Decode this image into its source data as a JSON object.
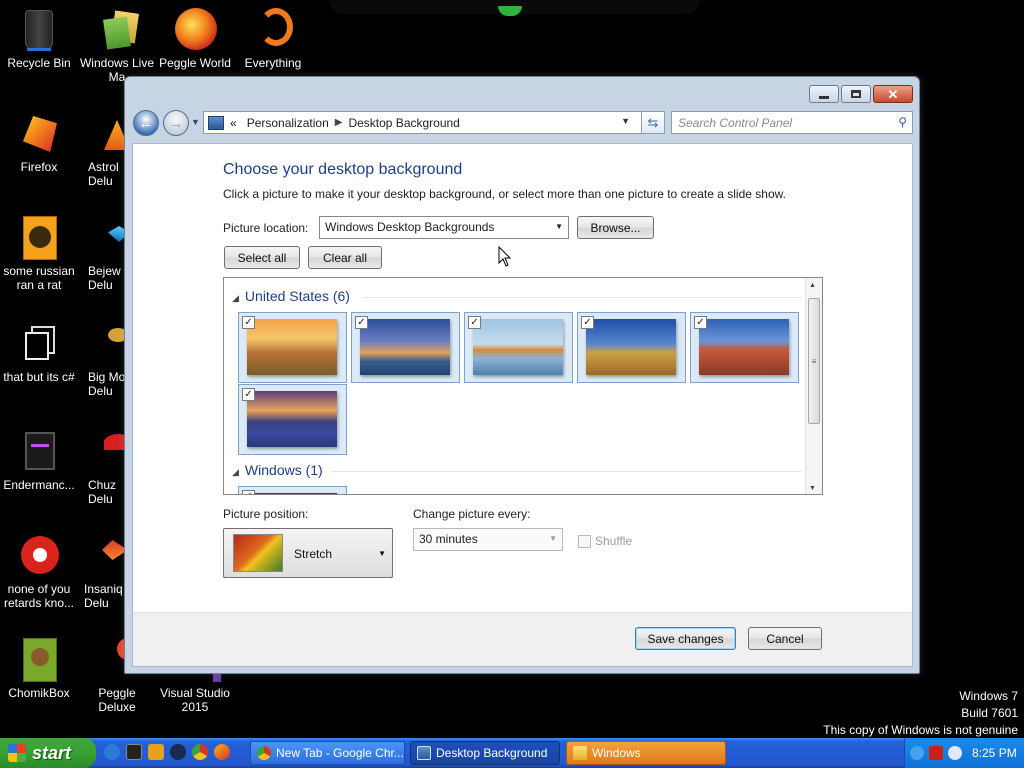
{
  "desktop": {
    "icons": [
      {
        "label": "Recycle Bin",
        "icon": "recycle-bin-icon"
      },
      {
        "label": "Windows Live Ma",
        "icon": "windows-live-icon"
      },
      {
        "label": "Peggle World",
        "icon": "peggle-world-icon"
      },
      {
        "label": "Everything",
        "icon": "everything-icon"
      },
      {
        "label": "Firefox",
        "icon": "firefox-icon"
      },
      {
        "label": "Astrol Delu",
        "icon": "astropop-icon"
      },
      {
        "label": "some russian ran a rat",
        "icon": "russian-rat-icon"
      },
      {
        "label": "Bejew Delu",
        "icon": "bejeweled-icon"
      },
      {
        "label": "that but its c#",
        "icon": "copy-icon"
      },
      {
        "label": "Big Mo Delu",
        "icon": "bigmoney-icon"
      },
      {
        "label": "Endermanc...",
        "icon": "enderman-icon"
      },
      {
        "label": "Chuz Delu",
        "icon": "chuzzle-icon"
      },
      {
        "label": "none of you retards kno...",
        "icon": "chrome-red-icon"
      },
      {
        "label": "Insaniq Delu",
        "icon": "insaniquarium-icon"
      },
      {
        "label": "ChomikBox",
        "icon": "chomikbox-icon"
      },
      {
        "label": "Peggle Deluxe",
        "icon": "peggle-deluxe-icon"
      },
      {
        "label": "Visual Studio 2015",
        "icon": "visual-studio-icon"
      }
    ],
    "genuine_notice": [
      "Windows 7",
      "Build 7601",
      "This copy of Windows is not genuine"
    ]
  },
  "window": {
    "breadcrumb": [
      "Personalization",
      "Desktop Background"
    ],
    "breadcrumb_prefix": "«",
    "search_placeholder": "Search Control Panel",
    "title": "Choose your desktop background",
    "subtitle": "Click a picture to make it your desktop background, or select more than one picture to create a slide show.",
    "picture_location_label": "Picture location:",
    "picture_location_value": "Windows Desktop Backgrounds",
    "browse_label": "Browse...",
    "select_all_label": "Select all",
    "clear_all_label": "Clear all",
    "groups": [
      {
        "name": "United States (6)",
        "count": 6,
        "checked": [
          true,
          true,
          true,
          true,
          true,
          true
        ]
      },
      {
        "name": "Windows (1)",
        "count": 1
      }
    ],
    "picture_position_label": "Picture position:",
    "picture_position_value": "Stretch",
    "change_every_label": "Change picture every:",
    "change_every_value": "30 minutes",
    "shuffle_label": "Shuffle",
    "save_label": "Save changes",
    "cancel_label": "Cancel"
  },
  "taskbar": {
    "start_label": "start",
    "tasks": [
      {
        "label": "New Tab - Google Chr...",
        "icon": "chrome-icon",
        "active": false
      },
      {
        "label": "Desktop Background",
        "icon": "control-panel-icon",
        "active": true
      },
      {
        "label": "Windows",
        "icon": "folder-icon",
        "active": false
      }
    ],
    "clock": "8:25 PM"
  }
}
